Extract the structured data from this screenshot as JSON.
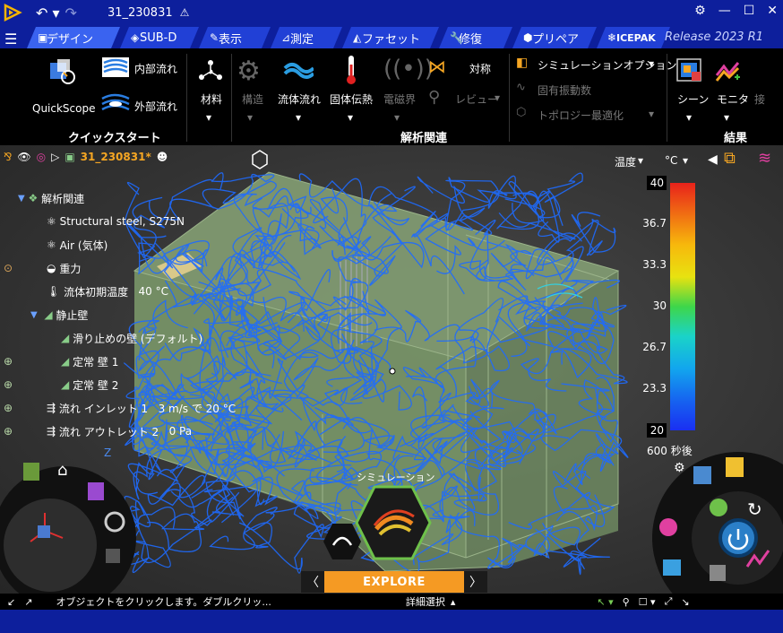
{
  "titlebar": {
    "title": "31_230831",
    "release": "Release 2023 R1"
  },
  "tabs": [
    {
      "label": "デザイン"
    },
    {
      "label": "SUB-D"
    },
    {
      "label": "表示"
    },
    {
      "label": "測定"
    },
    {
      "label": "ファセット"
    },
    {
      "label": "修復"
    },
    {
      "label": "プリペア"
    },
    {
      "label": "ICEPAK"
    }
  ],
  "ribbon": {
    "quickscope": "QuickScope",
    "internal_flow": "内部流れ",
    "external_flow": "外部流れ",
    "group_quickstart": "クイックスタート",
    "material": "材料",
    "structure": "構造",
    "fluid_flow": "流体流れ",
    "solid_heat": "固体伝熱",
    "electromagnetic": "電磁界",
    "symmetry": "対称",
    "review": "レビュー",
    "sim_options": "シミュレーションオプション",
    "natural_freq": "固有振動数",
    "topology_opt": "トポロジー最適化",
    "group_analysis": "解析関連",
    "scene": "シーン",
    "monitor": "モニタ",
    "more": "接",
    "group_results": "結果"
  },
  "tree": {
    "doc_name": "31_230831*",
    "root": "解析関連",
    "items": [
      {
        "label": "Structural steel, S275N",
        "value": ""
      },
      {
        "label": "Air (気体)",
        "value": ""
      },
      {
        "label": "重力",
        "value": ""
      },
      {
        "label": "流体初期温度",
        "value": "40 °C"
      },
      {
        "label": "静止壁",
        "value": ""
      },
      {
        "label": "滑り止めの壁 (デフォルト)",
        "value": ""
      },
      {
        "label": "定常 壁 1",
        "value": ""
      },
      {
        "label": "定常 壁 2",
        "value": ""
      },
      {
        "label": "流れ インレット 1",
        "value": "3 m/s   で   20 °C"
      },
      {
        "label": "流れ アウトレット 2",
        "value": "0 Pa"
      }
    ]
  },
  "legend": {
    "quantity": "温度",
    "unit": "°C",
    "ticks": [
      "40",
      "36.7",
      "33.3",
      "30",
      "26.7",
      "23.3",
      "20"
    ],
    "time": "600 秒後"
  },
  "viewport": {
    "sim_label": "シミュレーション"
  },
  "explore": {
    "label": "EXPLORE"
  },
  "status": {
    "hint": "オブジェクトをクリックします。ダブルクリッ...",
    "detail": "詳細選択"
  }
}
